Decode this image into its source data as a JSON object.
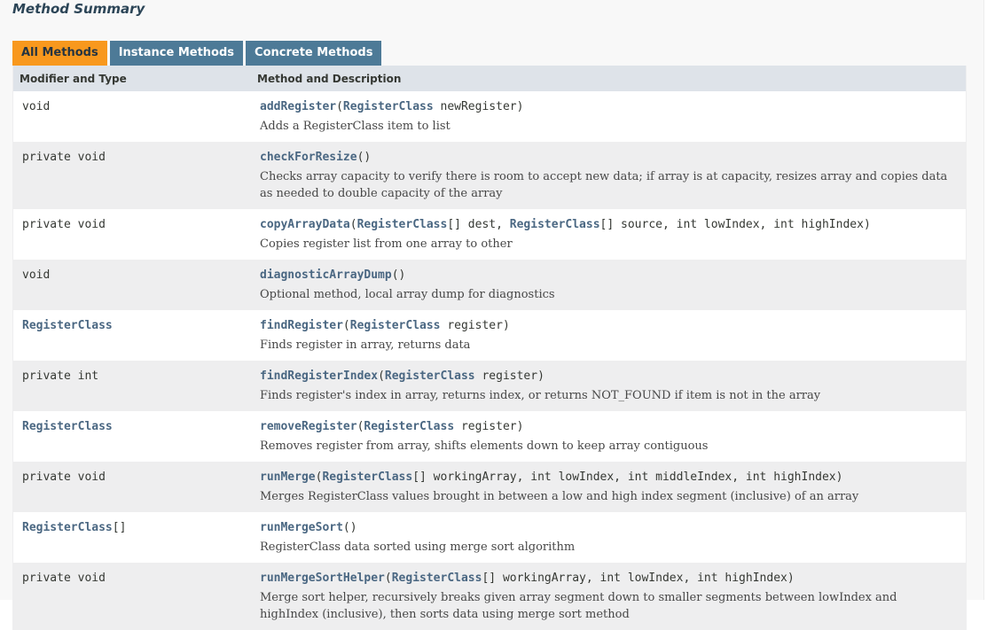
{
  "section_title": "Method Summary",
  "tabs": [
    {
      "label": "All Methods"
    },
    {
      "label": "Instance Methods"
    },
    {
      "label": "Concrete Methods"
    }
  ],
  "columns": {
    "type": "Modifier and Type",
    "method": "Method and Description"
  },
  "rows": [
    {
      "type_pre": "void",
      "type_link": "",
      "type_post": "",
      "sig": [
        {
          "t": "m",
          "v": "addRegister"
        },
        {
          "t": "x",
          "v": "("
        },
        {
          "t": "l",
          "v": "RegisterClass"
        },
        {
          "t": "x",
          "v": " newRegister)"
        }
      ],
      "desc": "Adds a RegisterClass item to list"
    },
    {
      "type_pre": "private void",
      "type_link": "",
      "type_post": "",
      "sig": [
        {
          "t": "m",
          "v": "checkForResize"
        },
        {
          "t": "x",
          "v": "()"
        }
      ],
      "desc": "Checks array capacity to verify there is room to accept new data; if array is at capacity, resizes array and copies data as needed to double capacity of the array"
    },
    {
      "type_pre": "private void",
      "type_link": "",
      "type_post": "",
      "sig": [
        {
          "t": "m",
          "v": "copyArrayData"
        },
        {
          "t": "x",
          "v": "("
        },
        {
          "t": "l",
          "v": "RegisterClass"
        },
        {
          "t": "x",
          "v": "[] dest, "
        },
        {
          "t": "l",
          "v": "RegisterClass"
        },
        {
          "t": "x",
          "v": "[] source, int lowIndex, int highIndex)"
        }
      ],
      "desc": "Copies register list from one array to other"
    },
    {
      "type_pre": "void",
      "type_link": "",
      "type_post": "",
      "sig": [
        {
          "t": "m",
          "v": "diagnosticArrayDump"
        },
        {
          "t": "x",
          "v": "()"
        }
      ],
      "desc": "Optional method, local array dump for diagnostics"
    },
    {
      "type_pre": "",
      "type_link": "RegisterClass",
      "type_post": "",
      "sig": [
        {
          "t": "m",
          "v": "findRegister"
        },
        {
          "t": "x",
          "v": "("
        },
        {
          "t": "l",
          "v": "RegisterClass"
        },
        {
          "t": "x",
          "v": " register)"
        }
      ],
      "desc": "Finds register in array, returns data"
    },
    {
      "type_pre": "private int",
      "type_link": "",
      "type_post": "",
      "sig": [
        {
          "t": "m",
          "v": "findRegisterIndex"
        },
        {
          "t": "x",
          "v": "("
        },
        {
          "t": "l",
          "v": "RegisterClass"
        },
        {
          "t": "x",
          "v": " register)"
        }
      ],
      "desc": "Finds register's index in array, returns index, or returns NOT_FOUND if item is not in the array"
    },
    {
      "type_pre": "",
      "type_link": "RegisterClass",
      "type_post": "",
      "sig": [
        {
          "t": "m",
          "v": "removeRegister"
        },
        {
          "t": "x",
          "v": "("
        },
        {
          "t": "l",
          "v": "RegisterClass"
        },
        {
          "t": "x",
          "v": " register)"
        }
      ],
      "desc": "Removes register from array, shifts elements down to keep array contiguous"
    },
    {
      "type_pre": "private void",
      "type_link": "",
      "type_post": "",
      "sig": [
        {
          "t": "m",
          "v": "runMerge"
        },
        {
          "t": "x",
          "v": "("
        },
        {
          "t": "l",
          "v": "RegisterClass"
        },
        {
          "t": "x",
          "v": "[] workingArray, int lowIndex, int middleIndex, int highIndex)"
        }
      ],
      "desc": "Merges RegisterClass values brought in between a low and high index segment (inclusive) of an array"
    },
    {
      "type_pre": "",
      "type_link": "RegisterClass",
      "type_post": "[]",
      "sig": [
        {
          "t": "m",
          "v": "runMergeSort"
        },
        {
          "t": "x",
          "v": "()"
        }
      ],
      "desc": "RegisterClass data sorted using merge sort algorithm"
    },
    {
      "type_pre": "private void",
      "type_link": "",
      "type_post": "",
      "sig": [
        {
          "t": "m",
          "v": "runMergeSortHelper"
        },
        {
          "t": "x",
          "v": "("
        },
        {
          "t": "l",
          "v": "RegisterClass"
        },
        {
          "t": "x",
          "v": "[] workingArray, int lowIndex, int highIndex)"
        }
      ],
      "desc": "Merge sort helper, recursively breaks given array segment down to smaller segments between lowIndex and highIndex (inclusive), then sorts data using merge sort method"
    }
  ],
  "colors": {
    "tab_active": "#f8981d",
    "tab_inactive": "#4d7a97",
    "header_bg": "#dee3e9",
    "row_alt": "#eeeeef",
    "link": "#4a6782"
  }
}
